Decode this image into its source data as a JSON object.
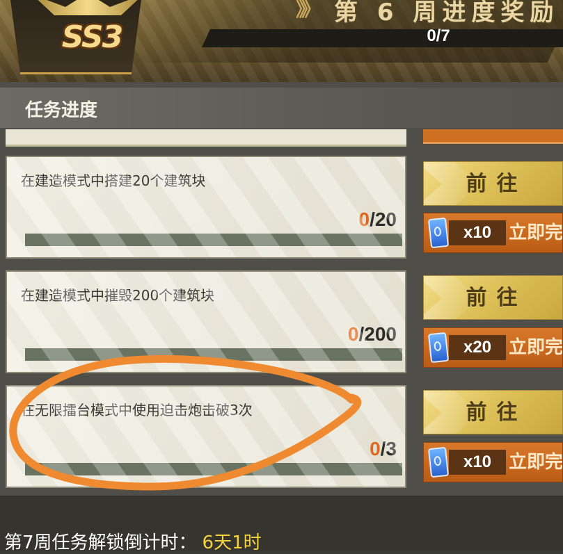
{
  "header": {
    "season_badge": "SS3",
    "title": "第 6 周进度奖励",
    "chevrons": "》》",
    "progress": "0/7",
    "progress_fraction": 0.0
  },
  "section": {
    "title": "任务进度"
  },
  "tasks": [
    {
      "description": "在建造模式中搭建20个建筑块",
      "done": "0",
      "total": "/20",
      "progress_fraction": 0.0,
      "go_label": "前往",
      "cost": "x10",
      "finish_label": "立即完成"
    },
    {
      "description": "在建造模式中摧毁200个建筑块",
      "done": "0",
      "total": "/200",
      "progress_fraction": 0.0,
      "go_label": "前往",
      "cost": "x20",
      "finish_label": "立即完成"
    },
    {
      "description": "在无限擂台模式中使用迫击炮击破3次",
      "done": "0",
      "total": "/3",
      "progress_fraction": 0.0,
      "go_label": "前往",
      "cost": "x10",
      "finish_label": "立即完成"
    }
  ],
  "footer": {
    "label": "第7周任务解锁倒计时：",
    "time": "6天1时"
  },
  "icons": {
    "ticket": "ticket-icon"
  },
  "colors": {
    "accent_orange": "#e26a1e",
    "gold_button": "#dec15a",
    "finish_button": "#cf6f22",
    "countdown": "#f6d23c",
    "annotation_stroke": "#f08a30"
  }
}
